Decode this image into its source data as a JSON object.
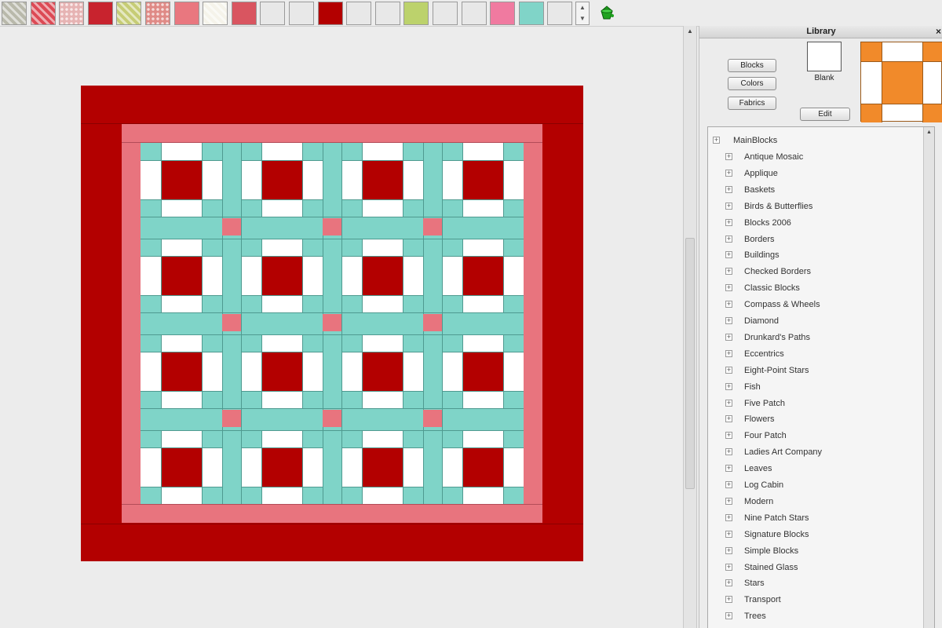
{
  "toolbar": {
    "swatches": [
      {
        "color": "#b9b9ab",
        "pattern": "a"
      },
      {
        "color": "#dc4a55",
        "pattern": "a"
      },
      {
        "color": "#e6b3b3",
        "pattern": "b"
      },
      {
        "color": "#c8232e",
        "pattern": "none"
      },
      {
        "color": "#c6cc76",
        "pattern": "a"
      },
      {
        "color": "#df8a86",
        "pattern": "b"
      },
      {
        "color": "#e9777f",
        "pattern": "none"
      },
      {
        "color": "#f5f3ea",
        "pattern": "a"
      },
      {
        "color": "#d95560",
        "pattern": "none"
      },
      {
        "color": "#e8e8e8",
        "pattern": "none"
      },
      {
        "color": "#e8e8e8",
        "pattern": "none"
      },
      {
        "color": "#b30000",
        "pattern": "none"
      },
      {
        "color": "#e8e8e8",
        "pattern": "none"
      },
      {
        "color": "#e8e8e8",
        "pattern": "none"
      },
      {
        "color": "#bcd26c",
        "pattern": "none"
      },
      {
        "color": "#e8e8e8",
        "pattern": "none"
      },
      {
        "color": "#e8e8e8",
        "pattern": "none"
      },
      {
        "color": "#f07aa0",
        "pattern": "none"
      },
      {
        "color": "#80d4c8",
        "pattern": "none"
      },
      {
        "color": "#e8e8e8",
        "pattern": "none"
      }
    ],
    "stepper_up": "▲",
    "stepper_down": "▼"
  },
  "quilt": {
    "border_color": "#b30000",
    "inner_border_color": "#e8747e",
    "sash_color": "#7fd4c8",
    "cornerstone_color": "#e8747e",
    "block_center_color": "#b30000",
    "block_light_color": "#ffffff",
    "rows": 4,
    "cols": 4
  },
  "library": {
    "title": "Library",
    "close_glyph": "×",
    "buttons": {
      "blocks": "Blocks",
      "colors": "Colors",
      "fabrics": "Fabrics",
      "edit": "Edit"
    },
    "blank_label": "Blank",
    "preview_color": "#f18a2a",
    "tree_root": "MainBlocks",
    "tree_items": [
      "Antique Mosaic",
      "Applique",
      "Baskets",
      "Birds & Butterflies",
      "Blocks 2006",
      "Borders",
      "Buildings",
      "Checked Borders",
      "Classic Blocks",
      "Compass & Wheels",
      "Diamond",
      "Drunkard's Paths",
      "Eccentrics",
      "Eight-Point Stars",
      "Fish",
      "Five Patch",
      "Flowers",
      "Four Patch",
      "Ladies Art Company",
      "Leaves",
      "Log Cabin",
      "Modern",
      "Nine Patch Stars",
      "Signature Blocks",
      "Simple Blocks",
      "Stained Glass",
      "Stars",
      "Transport",
      "Trees"
    ]
  }
}
